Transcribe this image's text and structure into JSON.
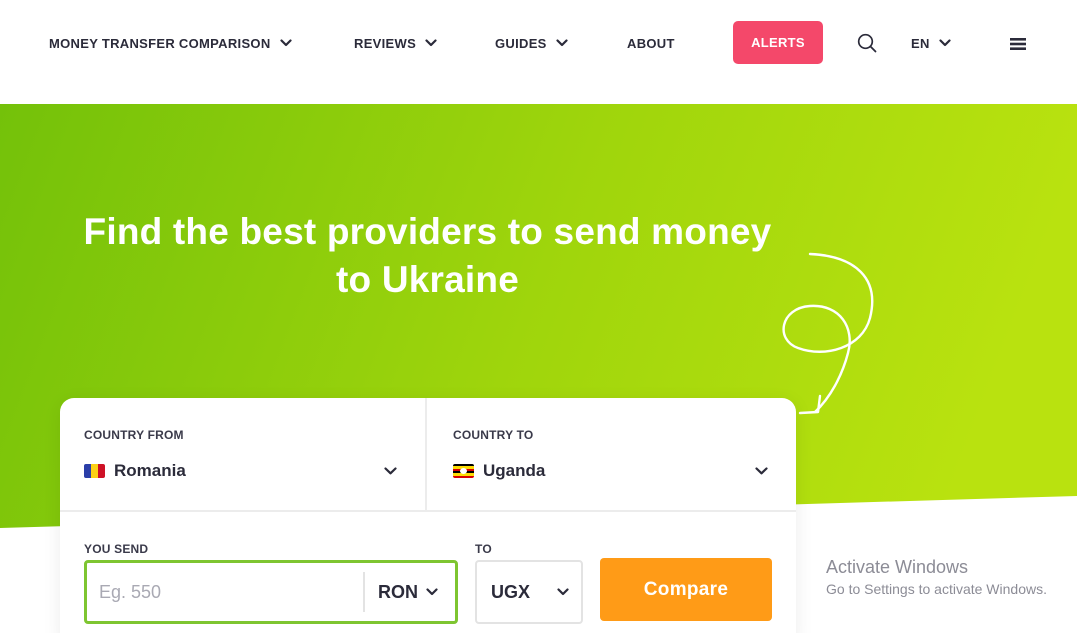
{
  "header": {
    "nav": [
      {
        "label": "MONEY TRANSFER COMPARISON",
        "has_dropdown": true
      },
      {
        "label": "REVIEWS",
        "has_dropdown": true
      },
      {
        "label": "GUIDES",
        "has_dropdown": true
      },
      {
        "label": "ABOUT",
        "has_dropdown": false
      }
    ],
    "alerts_label": "ALERTS",
    "language": "EN",
    "icons": [
      "search-icon",
      "menu-icon",
      "chevron-down-icon"
    ]
  },
  "hero": {
    "title_line1": "Find the best providers to send money",
    "title_line2": "to Ukraine"
  },
  "form": {
    "country_from_label": "COUNTRY FROM",
    "country_from_value": "Romania",
    "country_to_label": "COUNTRY TO",
    "country_to_value": "Uganda",
    "you_send_label": "YOU SEND",
    "amount_placeholder": "Eg. 550",
    "amount_value": "",
    "send_currency": "RON",
    "to_label": "TO",
    "receive_currency": "UGX",
    "compare_label": "Compare"
  },
  "watermark": {
    "title": "Activate Windows",
    "subtitle": "Go to Settings to activate Windows."
  },
  "colors": {
    "accent_red": "#f4486a",
    "hero_green_left": "#7cc50b",
    "hero_green_right": "#b7e00f",
    "input_border": "#7ec531",
    "compare_orange": "#ff9b17"
  }
}
